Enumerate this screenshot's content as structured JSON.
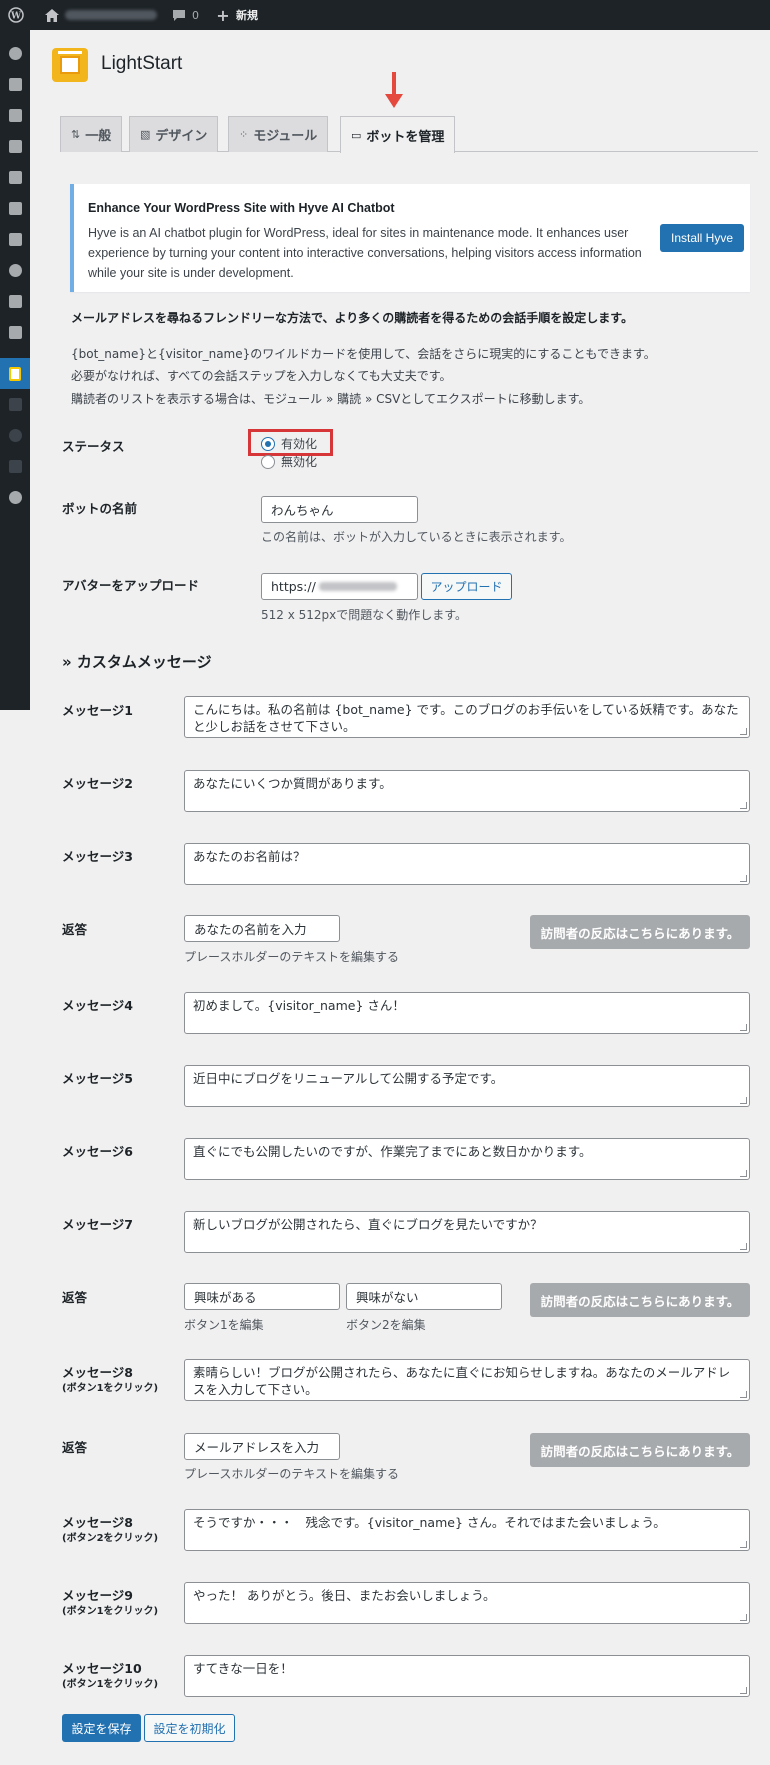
{
  "admin_bar": {
    "comments_count": "0",
    "new_label": "新規"
  },
  "app": {
    "title": "LightStart"
  },
  "tabs": [
    {
      "icon": "⇅",
      "label": "一般"
    },
    {
      "icon": "▧",
      "label": "デザイン"
    },
    {
      "icon": "⁘",
      "label": "モジュール"
    },
    {
      "icon": "▭",
      "label": "ボットを管理"
    }
  ],
  "notice": {
    "title": "Enhance Your WordPress Site with Hyve AI Chatbot",
    "body": "Hyve is an AI chatbot plugin for WordPress, ideal for sites in maintenance mode. It enhances user experience by turning your content into interactive conversations, helping visitors access information while your site is under development.",
    "button": "Install Hyve"
  },
  "intro": {
    "heading": "メールアドレスを尋ねるフレンドリーな方法で、より多くの購読者を得るための会話手順を設定します。",
    "line1": "{bot_name}と{visitor_name}のワイルドカードを使用して、会話をさらに現実的にすることもできます。",
    "line2": "必要がなければ、すべての会話ステップを入力しなくても大丈夫です。",
    "line3": "購読者のリストを表示する場合は、モジュール » 購読 » CSVとしてエクスポートに移動します。"
  },
  "status": {
    "label": "ステータス",
    "option_enabled": "有効化",
    "option_disabled": "無効化",
    "selected": "有効化"
  },
  "bot_name": {
    "label": "ボットの名前",
    "value": "わんちゃん",
    "help": "この名前は、ボットが入力しているときに表示されます。"
  },
  "avatar": {
    "label": "アバターをアップロード",
    "value_prefix": "https://",
    "button": "アップロード",
    "help": "512 x 512pxで問題なく動作します。"
  },
  "custom_messages": {
    "title": "» カスタムメッセージ",
    "response_button": "訪問者の反応はこちらにあります。",
    "reply_label": "返答",
    "placeholder_help": "プレースホルダーのテキストを編集する",
    "messages": [
      {
        "label": "メッセージ1",
        "sub": "",
        "text": "こんにちは。私の名前は {bot_name} です。このブログのお手伝いをしている妖精です。あなたと少しお話をさせて下さい。"
      },
      {
        "label": "メッセージ2",
        "sub": "",
        "text": "あなたにいくつか質問があります。"
      },
      {
        "label": "メッセージ3",
        "sub": "",
        "text": "あなたのお名前は？"
      },
      {
        "label": "メッセージ4",
        "sub": "",
        "text": "初めまして。{visitor_name} さん！"
      },
      {
        "label": "メッセージ5",
        "sub": "",
        "text": "近日中にブログをリニューアルして公開する予定です。"
      },
      {
        "label": "メッセージ6",
        "sub": "",
        "text": "直ぐにでも公開したいのですが、作業完了までにあと数日かかります。"
      },
      {
        "label": "メッセージ7",
        "sub": "",
        "text": "新しいブログが公開されたら、直ぐにブログを見たいですか？"
      },
      {
        "label": "メッセージ8",
        "sub": "(ボタン1をクリック)",
        "text": "素晴らしい！ブログが公開されたら、あなたに直ぐにお知らせしますね。あなたのメールアドレスを入力して下さい。"
      },
      {
        "label": "メッセージ8",
        "sub": "(ボタン2をクリック)",
        "text": "そうですか・・・　残念です。{visitor_name} さん。それではまた会いましょう。"
      },
      {
        "label": "メッセージ9",
        "sub": "(ボタン1をクリック)",
        "text": "やった！ ありがとう。後日、またお会いしましょう。"
      },
      {
        "label": "メッセージ10",
        "sub": "(ボタン1をクリック)",
        "text": "すてきな一日を！"
      }
    ],
    "reply1": {
      "value": "あなたの名前を入力"
    },
    "reply2": {
      "button1": "興味がある",
      "button2": "興味がない",
      "help1": "ボタン1を編集",
      "help2": "ボタン2を編集"
    },
    "reply3": {
      "value": "メールアドレスを入力"
    }
  },
  "footer": {
    "save": "設定を保存",
    "reset": "設定を初期化"
  }
}
